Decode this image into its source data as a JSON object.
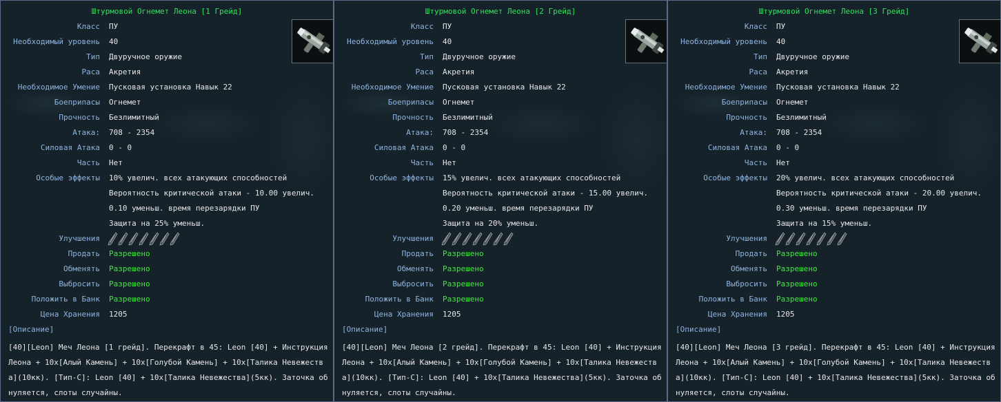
{
  "panels": [
    {
      "title": "Штурмовой Огнемет Леона [1 Грейд]",
      "rows": [
        {
          "label": "Класс",
          "value": "ПУ"
        },
        {
          "label": "Необходимый уровень",
          "value": "40"
        },
        {
          "label": "Тип",
          "value": "Двуручное оружие"
        },
        {
          "label": "Раса",
          "value": "Акретия"
        },
        {
          "label": "Необходимое Умение",
          "value": "Пусковая установка Навык 22"
        },
        {
          "label": "Боеприпасы",
          "value": "Огнемет"
        },
        {
          "label": "Прочность",
          "value": "Безлимитный"
        },
        {
          "label": "Атака:",
          "value": "708 - 2354"
        },
        {
          "label": "Силовая Атака",
          "value": "0 - 0"
        },
        {
          "label": "Часть",
          "value": "Нет"
        },
        {
          "label": "Особые эффекты",
          "value": "10% увелич. всех атакующих способностей"
        }
      ],
      "effects_extra": [
        "Вероятность критической атаки - 10.00 увелич.",
        "0.10 уменьш. время перезарядки ПУ",
        "Защита на 25% уменьш."
      ],
      "upgrades_label": "Улучшения",
      "upgrade_slots": 7,
      "permissions": [
        {
          "label": "Продать",
          "value": "Разрешено"
        },
        {
          "label": "Обменять",
          "value": "Разрешено"
        },
        {
          "label": "Выбросить",
          "value": "Разрешено"
        },
        {
          "label": "Положить в Банк",
          "value": "Разрешено"
        }
      ],
      "storage_label": "Цена Хранения",
      "storage_value": "1205",
      "desc_header": "[Описание]",
      "description": "[40][Leon] Меч Леона [1 грейд]. Перекрафт в 45: Leon [40] + Инструкция Леона + 10x[Алый Камень] + 10x[Голубой Камень] + 10x[Талика Невежества](10кк). [Тип-С]: Leon [40] + 10x[Талика Невежества](5кк). Заточка обнуляется, слоты случайны."
    },
    {
      "title": "Штурмовой Огнемет Леона [2 Грейд]",
      "rows": [
        {
          "label": "Класс",
          "value": "ПУ"
        },
        {
          "label": "Необходимый уровень",
          "value": "40"
        },
        {
          "label": "Тип",
          "value": "Двуручное оружие"
        },
        {
          "label": "Раса",
          "value": "Акретия"
        },
        {
          "label": "Необходимое Умение",
          "value": "Пусковая установка Навык 22"
        },
        {
          "label": "Боеприпасы",
          "value": "Огнемет"
        },
        {
          "label": "Прочность",
          "value": "Безлимитный"
        },
        {
          "label": "Атака:",
          "value": "708 - 2354"
        },
        {
          "label": "Силовая Атака",
          "value": "0 - 0"
        },
        {
          "label": "Часть",
          "value": "Нет"
        },
        {
          "label": "Особые эффекты",
          "value": "15% увелич. всех атакующих способностей"
        }
      ],
      "effects_extra": [
        "Вероятность критической атаки - 15.00 увелич.",
        "0.20 уменьш. время перезарядки ПУ",
        "Защита на 20% уменьш."
      ],
      "upgrades_label": "Улучшения",
      "upgrade_slots": 7,
      "permissions": [
        {
          "label": "Продать",
          "value": "Разрешено"
        },
        {
          "label": "Обменять",
          "value": "Разрешено"
        },
        {
          "label": "Выбросить",
          "value": "Разрешено"
        },
        {
          "label": "Положить в Банк",
          "value": "Разрешено"
        }
      ],
      "storage_label": "Цена Хранения",
      "storage_value": "1205",
      "desc_header": "[Описание]",
      "description": "[40][Leon] Меч Леона [2 грейд]. Перекрафт в 45: Leon [40] + Инструкция Леона + 10x[Алый Камень] + 10x[Голубой Камень] + 10x[Талика Невежества](10кк). [Тип-С]: Leon [40] + 10x[Талика Невежества](5кк). Заточка обнуляется, слоты случайны."
    },
    {
      "title": "Штурмовой Огнемет Леона [3 Грейд]",
      "rows": [
        {
          "label": "Класс",
          "value": "ПУ"
        },
        {
          "label": "Необходимый уровень",
          "value": "40"
        },
        {
          "label": "Тип",
          "value": "Двуручное оружие"
        },
        {
          "label": "Раса",
          "value": "Акретия"
        },
        {
          "label": "Необходимое Умение",
          "value": "Пусковая установка Навык 22"
        },
        {
          "label": "Боеприпасы",
          "value": "Огнемет"
        },
        {
          "label": "Прочность",
          "value": "Безлимитный"
        },
        {
          "label": "Атака:",
          "value": "708 - 2354"
        },
        {
          "label": "Силовая Атака",
          "value": "0 - 0"
        },
        {
          "label": "Часть",
          "value": "Нет"
        },
        {
          "label": "Особые эффекты",
          "value": "20% увелич. всех атакующих способностей"
        }
      ],
      "effects_extra": [
        "Вероятность критической атаки - 20.00 увелич.",
        "0.30 уменьш. время перезарядки ПУ",
        "Защита на 15% уменьш."
      ],
      "upgrades_label": "Улучшения",
      "upgrade_slots": 7,
      "permissions": [
        {
          "label": "Продать",
          "value": "Разрешено"
        },
        {
          "label": "Обменять",
          "value": "Разрешено"
        },
        {
          "label": "Выбросить",
          "value": "Разрешено"
        },
        {
          "label": "Положить в Банк",
          "value": "Разрешено"
        }
      ],
      "storage_label": "Цена Хранения",
      "storage_value": "1205",
      "desc_header": "[Описание]",
      "description": "[40][Leon] Меч Леона [3 грейд]. Перекрафт в 45: Leon [40] + Инструкция Леона + 10x[Алый Камень] + 10x[Голубой Камень] + 10x[Талика Невежества](10кк). [Тип-С]: Leon [40] + 10x[Талика Невежества](5кк). Заточка обнуляется, слоты случайны."
    }
  ],
  "icons": {
    "item": "flamethrower-icon",
    "slot": "empty-upgrade-slot-icon"
  },
  "colors": {
    "title": "#2fe35a",
    "label": "#8fb4e0",
    "value": "#e6e6e6",
    "allowed": "#3aef3a",
    "border": "#5d6a86"
  }
}
